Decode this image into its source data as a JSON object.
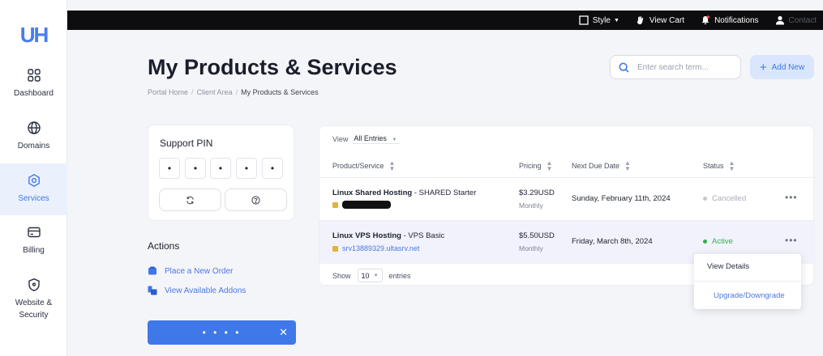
{
  "sidebar": {
    "logo": "UH",
    "items": [
      {
        "label": "Dashboard",
        "icon": "grid-icon"
      },
      {
        "label": "Domains",
        "icon": "globe-icon"
      },
      {
        "label": "Services",
        "icon": "services-icon"
      },
      {
        "label": "Billing",
        "icon": "card-icon"
      },
      {
        "label": "Website & Security",
        "icon": "shield-icon"
      }
    ],
    "active": "Services"
  },
  "topbar": {
    "style_label": "Style",
    "cart_label": "View Cart",
    "notifications_label": "Notifications",
    "user_label": "Contact"
  },
  "header": {
    "title": "My Products & Services",
    "breadcrumb": [
      "Portal Home",
      "Client Area",
      "My Products & Services"
    ],
    "search_placeholder": "Enter search term...",
    "add_new_label": "Add New"
  },
  "support_pin": {
    "title": "Support PIN",
    "digits": [
      "•",
      "•",
      "•",
      "•",
      "•"
    ]
  },
  "actions": {
    "title": "Actions",
    "links": [
      "Place a New Order",
      "View Available Addons"
    ]
  },
  "table": {
    "view_label": "View",
    "view_value": "All Entries",
    "columns": [
      "Product/Service",
      "Pricing",
      "Next Due Date",
      "Status"
    ],
    "rows": [
      {
        "product": "Linux Shared Hosting",
        "plan": " - SHARED Starter",
        "domain": "",
        "price": "$3.29USD",
        "cycle": "Monthly",
        "due": "Sunday, February 11th, 2024",
        "status": "Cancelled",
        "status_color": "#a9aeb9",
        "status_dot": "#c3c7cf"
      },
      {
        "product": "Linux VPS Hosting",
        "plan": " - VPS Basic",
        "domain": "srv13889329.ultasrv.net",
        "price": "$5.50USD",
        "cycle": "Monthly",
        "due": "Friday, March 8th, 2024",
        "status": "Active",
        "status_color": "#2fb34a",
        "status_dot": "#2fb34a"
      }
    ],
    "show_label": "Show",
    "show_value": "10",
    "entries_label": "entries"
  },
  "dropdown": {
    "items": [
      "View Details",
      "Upgrade/Downgrade"
    ]
  },
  "floatbar": {
    "dots": "• • • •",
    "close": "✕"
  },
  "colors": {
    "accent": "#3f78e8",
    "active_bg": "#eaf1fd"
  }
}
